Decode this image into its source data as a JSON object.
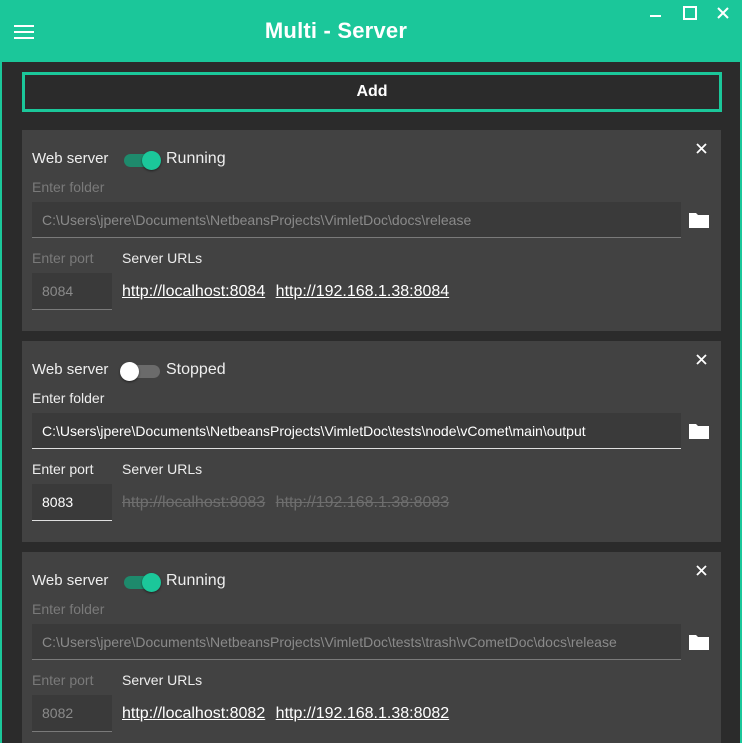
{
  "app": {
    "title": "Multi - Server",
    "add_label": "Add"
  },
  "colors": {
    "accent": "#1bc79a",
    "background": "#2b2b2b",
    "card": "#424242"
  },
  "servers": [
    {
      "web_server_label": "Web server",
      "status": "Running",
      "enabled": true,
      "folder_label": "Enter folder",
      "folder_value": "C:\\Users\\jpere\\Documents\\NetbeansProjects\\VimletDoc\\docs\\release",
      "port_label": "Enter port",
      "port_value": "8084",
      "urls_label": "Server URLs",
      "urls": [
        "http://localhost:8084",
        "http://192.168.1.38:8084"
      ]
    },
    {
      "web_server_label": "Web server",
      "status": "Stopped",
      "enabled": false,
      "folder_label": "Enter folder",
      "folder_value": "C:\\Users\\jpere\\Documents\\NetbeansProjects\\VimletDoc\\tests\\node\\vComet\\main\\output",
      "port_label": "Enter port",
      "port_value": "8083",
      "urls_label": "Server URLs",
      "urls": [
        "http://localhost:8083",
        "http://192.168.1.38:8083"
      ]
    },
    {
      "web_server_label": "Web server",
      "status": "Running",
      "enabled": true,
      "folder_label": "Enter folder",
      "folder_value": "C:\\Users\\jpere\\Documents\\NetbeansProjects\\VimletDoc\\tests\\trash\\vCometDoc\\docs\\release",
      "port_label": "Enter port",
      "port_value": "8082",
      "urls_label": "Server URLs",
      "urls": [
        "http://localhost:8082",
        "http://192.168.1.38:8082"
      ]
    }
  ]
}
